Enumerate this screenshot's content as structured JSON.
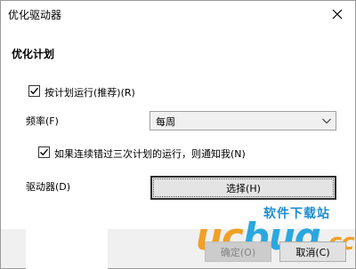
{
  "window": {
    "title": "优化驱动器"
  },
  "section": {
    "title": "优化计划"
  },
  "schedule": {
    "label": "按计划运行(推荐)(R)",
    "checked": true
  },
  "frequency": {
    "label": "频率(F)",
    "selected": "每周"
  },
  "notify": {
    "label": "如果连续错过三次计划的运行，则通知我(N)",
    "checked": true
  },
  "drives": {
    "label": "驱动器(D)",
    "button_label": "选择(H)"
  },
  "footer": {
    "ok_label": "确定(O)",
    "cancel_label": "取消(C)"
  },
  "watermark": {
    "text_orange": "uc",
    "text_blue": "bug",
    "suffix": ".cc",
    "chinese": "软件下载站"
  },
  "colors": {
    "watermark_orange": "#f0a026",
    "watermark_blue": "#2ba7e0"
  }
}
